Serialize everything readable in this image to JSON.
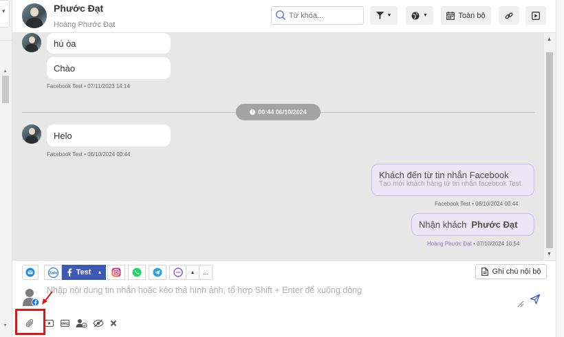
{
  "header": {
    "name": "Phước Đạt",
    "subname": "Hoàng Phước Đạt",
    "search_placeholder": "Từ khóa...",
    "scope_label": "Toàn bộ"
  },
  "messages": {
    "first_group": {
      "m1": "hú òa",
      "m2": "Chào",
      "meta": "Facebook Test • 07/11/2023 14:14"
    },
    "date_divider": "00:44 06/10/2024",
    "second_group": {
      "m1": "Helo",
      "meta": "Facebook Test • 06/10/2024 00:44"
    },
    "outgoing_1": {
      "title": "Khách đến từ tin nhắn Facebook",
      "subtitle": "Tạo mới khách hàng từ tin nhắn facebook Test",
      "meta": "Facebook Test • 06/10/2024 00:44"
    },
    "outgoing_2": {
      "prefix": "Nhận khách",
      "name": "Phước Đạt",
      "meta_author": "Hoàng Phước Đạt",
      "meta_time": "• 07/10/2024 10:54"
    }
  },
  "composer": {
    "active_channel": "Test",
    "more_label": "...",
    "internal_note": "Ghi chú nội bộ",
    "placeholder": "Nhập nội dung tin nhắn hoặc kéo thả hình ảnh, tổ hợp Shift + Enter để xuống dòng"
  },
  "colors": {
    "accent": "#3b59b5",
    "bubble_out_bg": "#ece7f7",
    "bubble_out_border": "#c7b8ea",
    "chat_bg": "#e7e7e7",
    "highlight": "#e01515"
  },
  "icons": {
    "search": "search-icon",
    "filter": "filter-icon",
    "globe": "globe-icon",
    "calendar": "calendar-icon",
    "link": "link-icon",
    "play": "play-icon",
    "attach": "paperclip-icon",
    "send": "send-icon"
  }
}
